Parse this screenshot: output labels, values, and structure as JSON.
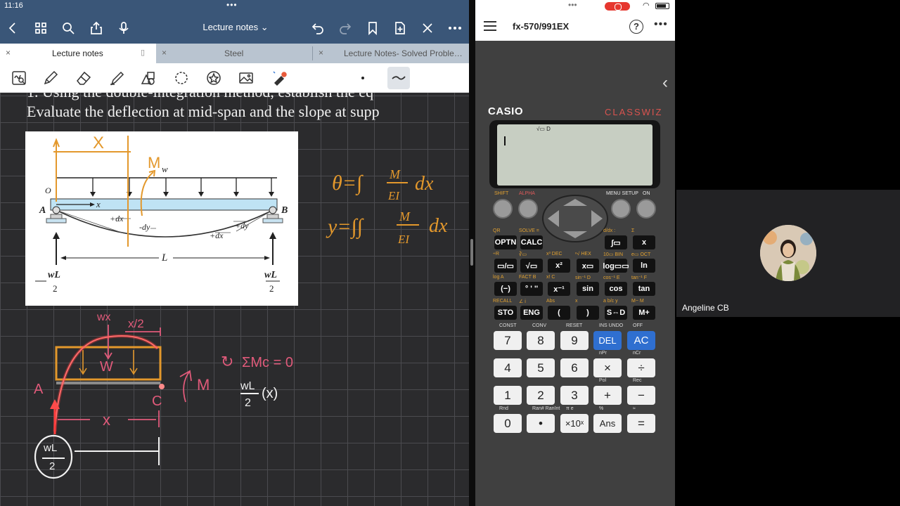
{
  "status_bar": {
    "time": "11:16",
    "dots": "•••"
  },
  "notes_app": {
    "title": "Lecture notes",
    "tabs": [
      {
        "label": "Lecture notes",
        "active": true
      },
      {
        "label": "Steel",
        "active": false
      },
      {
        "label": "Lecture Notes- Solved Proble…",
        "active": false
      }
    ],
    "toolbar_icons": [
      "zoom-box-icon",
      "pen-icon",
      "eraser-icon",
      "highlighter-icon",
      "shapes-icon",
      "lasso-icon",
      "sticker-icon",
      "image-icon",
      "laser-pointer-icon",
      "dot-size-icon",
      "stroke-style-icon"
    ],
    "problem_text": [
      "1. Using the double-integration method, establish the eq",
      "Evaluate the deflection at mid-span and the slope at supp"
    ],
    "figure": {
      "labels": {
        "x": "X",
        "M": "M",
        "w": "w",
        "O": "O",
        "A": "A",
        "B": "B",
        "xaxis": "x",
        "dx1": "+dx",
        "dy1": "-dy",
        "dy2": "+dy",
        "dx2": "+dx",
        "L": "L",
        "reaction": "wL",
        "two": "2"
      }
    },
    "handwriting": {
      "slope_eq_lhs": "θ=∫",
      "y_eq_lhs": "y=∫∫",
      "frac_num": "M",
      "frac_den": "EI",
      "dx": "dx",
      "wx": "wx",
      "half_x": "x/2",
      "W": "W",
      "A": "A",
      "C": "C",
      "M_moment": "M",
      "x_dim": "x",
      "reaction_num": "wL",
      "reaction_den": "2",
      "sum_moments": "ΣMc = 0",
      "term_num": "wL",
      "term_den": "2",
      "term_x": "(x)"
    }
  },
  "calculator": {
    "model": "fx-570/991EX",
    "brand": "CASIO",
    "series": "CLASSWIZ",
    "lcd_indicator": "√▭ D",
    "top_labels": {
      "shift": "SHIFT",
      "alpha": "ALPHA",
      "menu": "MENU SETUP",
      "on": "ON"
    },
    "func_rows": [
      [
        {
          "top": "QR",
          "label": "OPTN"
        },
        {
          "top": "SOLVE =",
          "label": "CALC"
        },
        {
          "top": "",
          "label": ""
        },
        {
          "top": "",
          "label": ""
        },
        {
          "top": "d/dx  :",
          "label": "∫▭"
        },
        {
          "top": "Σ",
          "label": "x"
        }
      ],
      [
        {
          "top": "÷R",
          "label": "▭/▭"
        },
        {
          "top": "∛▭",
          "label": "√▭"
        },
        {
          "top": "x³  DEC",
          "label": "x²"
        },
        {
          "top": "ⁿ√  HEX",
          "label": "x▭"
        },
        {
          "top": "10▭  BIN",
          "label": "log▭▭"
        },
        {
          "top": "e▭  OCT",
          "label": "ln"
        }
      ],
      [
        {
          "top": "log  A",
          "label": "(−)"
        },
        {
          "top": "FACT  B",
          "label": "° ' ''"
        },
        {
          "top": "x!  C",
          "label": "x⁻¹"
        },
        {
          "top": "sin⁻¹  D",
          "label": "sin"
        },
        {
          "top": "cos⁻¹  E",
          "label": "cos"
        },
        {
          "top": "tan⁻¹  F",
          "label": "tan"
        }
      ],
      [
        {
          "top": "RECALL",
          "label": "STO"
        },
        {
          "top": "∠  i",
          "label": "ENG"
        },
        {
          "top": "Abs",
          "label": "("
        },
        {
          "top": "x",
          "label": ")"
        },
        {
          "top": "a b/c  y",
          "label": "S⇔D"
        },
        {
          "top": "M−  M",
          "label": "M+"
        }
      ]
    ],
    "num_rows": [
      [
        {
          "top": "CONST",
          "label": "7"
        },
        {
          "top": "CONV",
          "label": "8"
        },
        {
          "top": "RESET",
          "label": "9"
        },
        {
          "top": "INS  UNDO",
          "label": "DEL",
          "blue": true
        },
        {
          "top": "OFF",
          "label": "AC",
          "blue": true
        }
      ],
      [
        {
          "top": "",
          "label": "4"
        },
        {
          "top": "",
          "label": "5"
        },
        {
          "top": "",
          "label": "6"
        },
        {
          "top": "nPr",
          "label": "×"
        },
        {
          "top": "nCr",
          "label": "÷"
        }
      ],
      [
        {
          "top": "",
          "label": "1"
        },
        {
          "top": "",
          "label": "2"
        },
        {
          "top": "",
          "label": "3"
        },
        {
          "top": "Pol",
          "label": "+"
        },
        {
          "top": "Rec",
          "label": "−"
        }
      ],
      [
        {
          "top": "Rnd",
          "label": "0"
        },
        {
          "top": "Ran#  RanInt",
          "label": "•"
        },
        {
          "top": "π  e",
          "label": "×10ˣ"
        },
        {
          "top": "%",
          "label": "Ans"
        },
        {
          "top": "≈",
          "label": "="
        }
      ]
    ]
  },
  "video": {
    "participant": "Angeline CB"
  }
}
